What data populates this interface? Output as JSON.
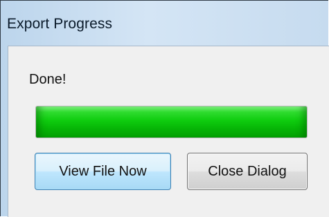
{
  "window": {
    "title": "Export Progress"
  },
  "status": {
    "text": "Done!"
  },
  "progress": {
    "fraction": 1.0,
    "color": "#0fcc0f"
  },
  "buttons": {
    "view_file_label": "View File Now",
    "close_dialog_label": "Close Dialog"
  }
}
